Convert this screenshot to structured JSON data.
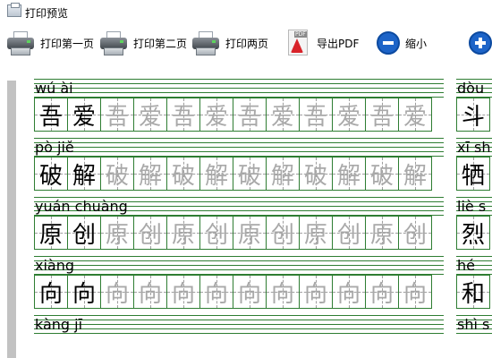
{
  "window": {
    "title": "打印预览"
  },
  "toolbar": {
    "print_first": "打印第一页",
    "print_second": "打印第二页",
    "print_both": "打印两页",
    "export_pdf": "导出PDF",
    "zoom_out": "缩小"
  },
  "page_left": {
    "rows": [
      {
        "pinyin": "wú ài",
        "chars": [
          "吾",
          "爱",
          "吾",
          "爱",
          "吾",
          "爱",
          "吾",
          "爱",
          "吾",
          "爱",
          "吾",
          "爱"
        ]
      },
      {
        "pinyin": "pò jiě",
        "chars": [
          "破",
          "解",
          "破",
          "解",
          "破",
          "解",
          "破",
          "解",
          "破",
          "解",
          "破",
          "解"
        ]
      },
      {
        "pinyin": "yuán chuàng",
        "chars": [
          "原",
          "创",
          "原",
          "创",
          "原",
          "创",
          "原",
          "创",
          "原",
          "创",
          "原",
          "创"
        ]
      },
      {
        "pinyin": "xiàng",
        "chars": [
          "向",
          "向",
          "向",
          "向",
          "向",
          "向",
          "向",
          "向",
          "向",
          "向",
          "向",
          "向"
        ]
      },
      {
        "pinyin": "kàng jī",
        "chars": []
      }
    ]
  },
  "page_right": {
    "rows": [
      {
        "pinyin": "dòu",
        "chars": [
          "斗"
        ]
      },
      {
        "pinyin": "xī sh",
        "chars": [
          "牺"
        ]
      },
      {
        "pinyin": "liè s",
        "chars": [
          "烈"
        ]
      },
      {
        "pinyin": "hé",
        "chars": [
          "和"
        ]
      },
      {
        "pinyin": "shì s",
        "chars": []
      }
    ]
  },
  "colors": {
    "grid_line": "#2e7d32",
    "trace_char": "#a9a9a9",
    "zoom_icon": "#1d64c8"
  }
}
